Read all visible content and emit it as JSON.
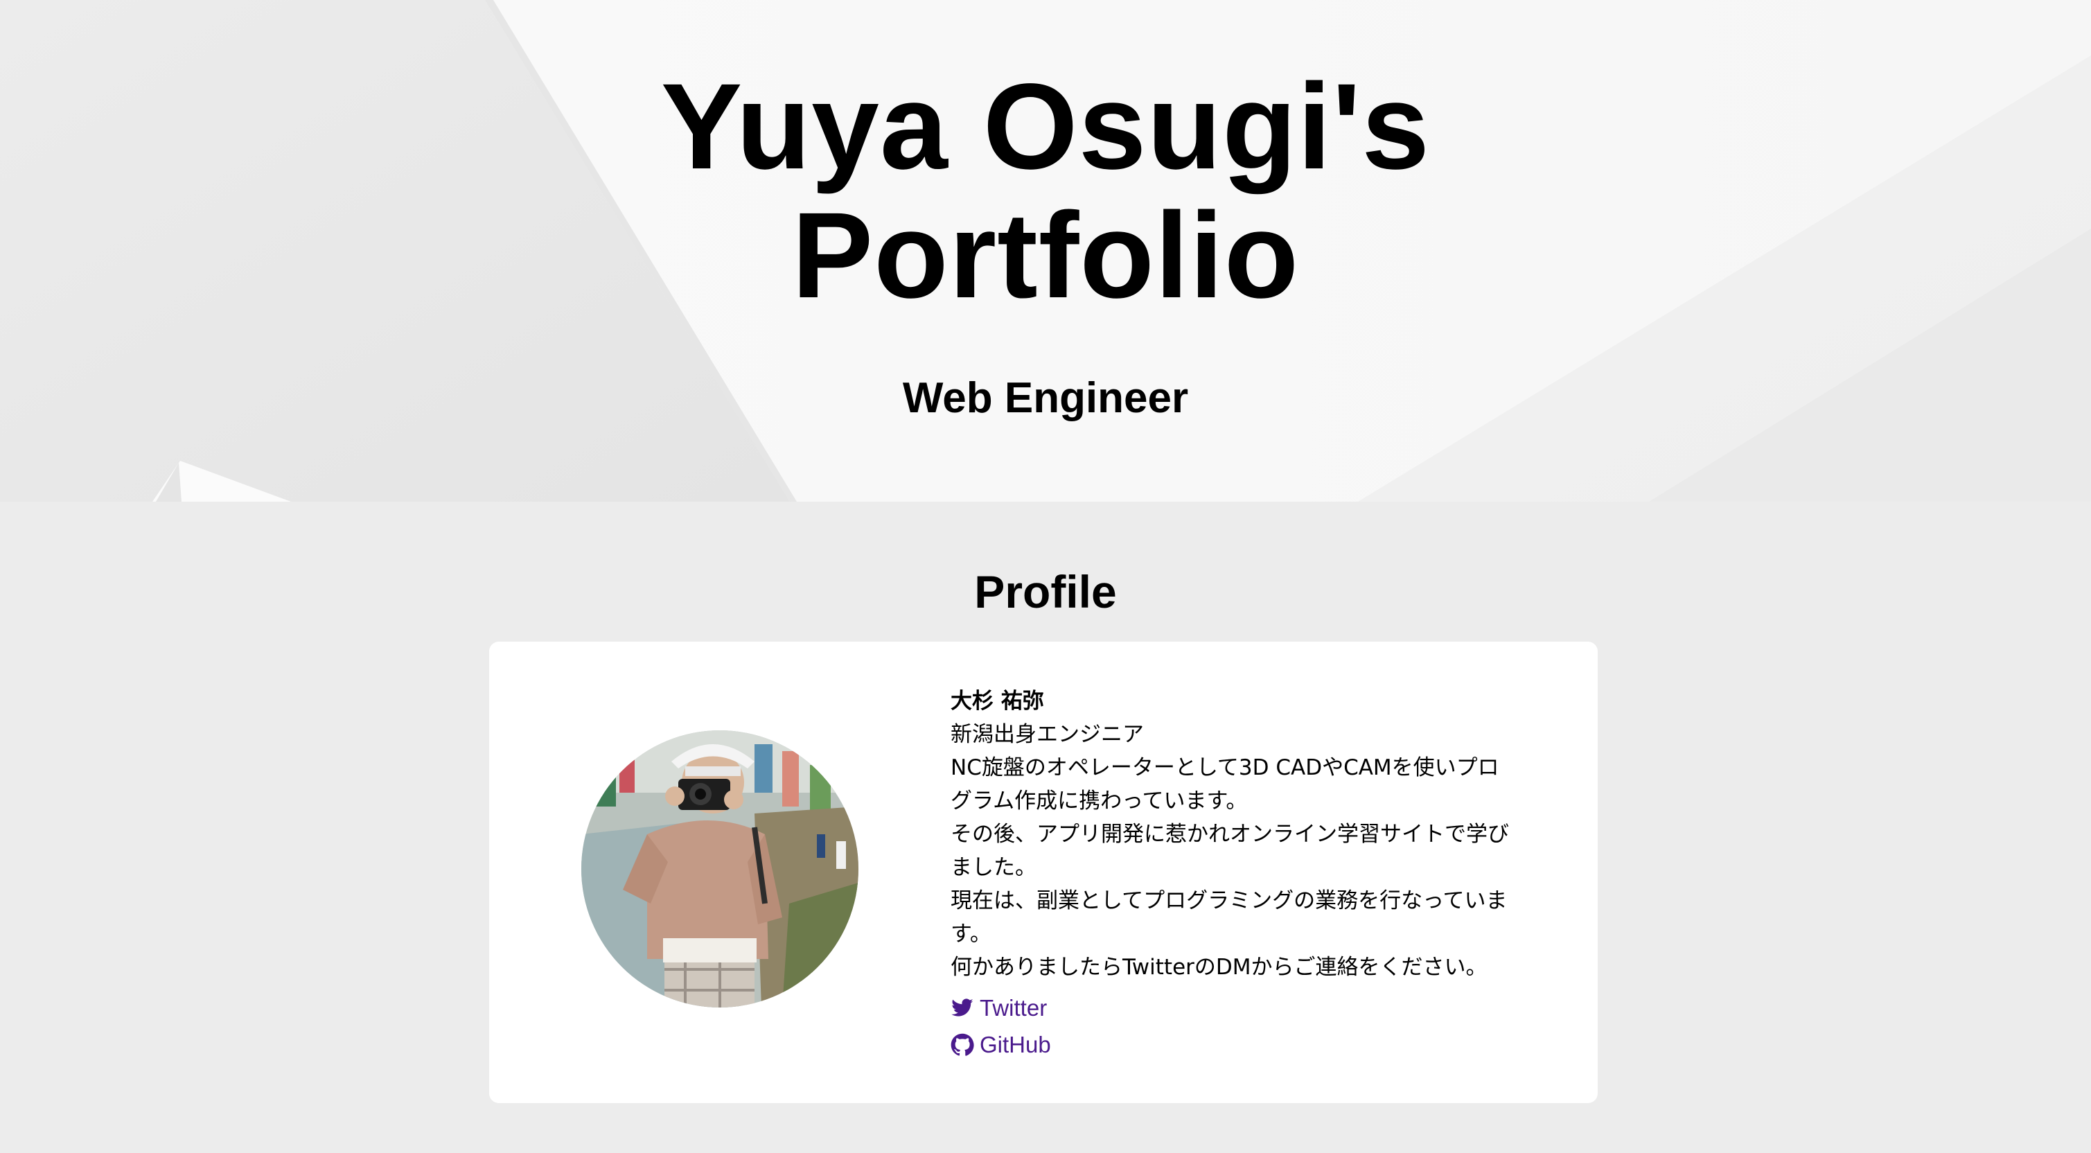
{
  "hero": {
    "title_line1": "Yuya Osugi's",
    "title_line2": "Portfolio",
    "subtitle": "Web Engineer"
  },
  "profile": {
    "section_title": "Profile",
    "name": "大杉 祐弥",
    "bio_lines": [
      "新潟出身エンジニア",
      "NC旋盤のオペレーターとして3D CADやCAMを使いプログラム作成に携わっています。",
      "その後、アプリ開発に惹かれオンライン学習サイトで学びました。",
      "現在は、副業としてプログラミングの業務を行なっています。",
      "何かありましたらTwitterのDMからご連絡をください。"
    ],
    "links": [
      {
        "label": "Twitter",
        "icon": "twitter-icon"
      },
      {
        "label": "GitHub",
        "icon": "github-icon"
      }
    ]
  },
  "colors": {
    "page_background": "#ececec",
    "card_background": "#ffffff",
    "link": "#4a1a8c",
    "text": "#000000"
  }
}
